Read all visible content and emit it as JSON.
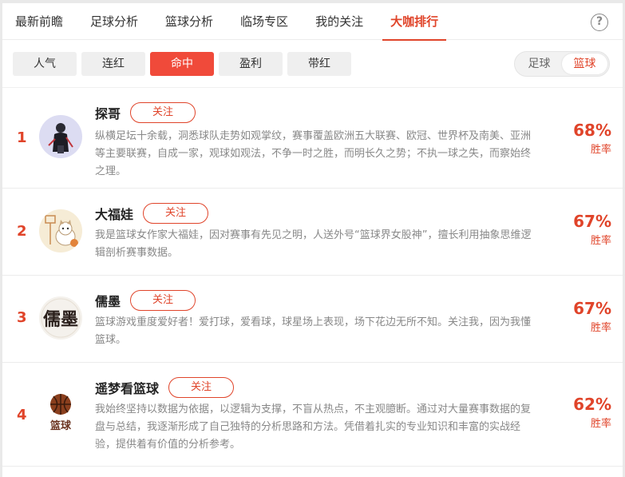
{
  "tabs": [
    {
      "label": "最新前瞻",
      "active": false
    },
    {
      "label": "足球分析",
      "active": false
    },
    {
      "label": "篮球分析",
      "active": false
    },
    {
      "label": "临场专区",
      "active": false
    },
    {
      "label": "我的关注",
      "active": false
    },
    {
      "label": "大咖排行",
      "active": true
    }
  ],
  "help_label": "?",
  "filters": [
    {
      "label": "人气",
      "active": false
    },
    {
      "label": "连红",
      "active": false
    },
    {
      "label": "命中",
      "active": true
    },
    {
      "label": "盈利",
      "active": false
    },
    {
      "label": "带红",
      "active": false
    }
  ],
  "sport_toggle": [
    {
      "label": "足球",
      "active": false
    },
    {
      "label": "篮球",
      "active": true
    }
  ],
  "follow_label": "关注",
  "experts": [
    {
      "rank": "1",
      "name": "探哥",
      "desc": "纵横足坛十余载，洞悉球队走势如观掌纹，赛事覆盖欧洲五大联赛、欧冠、世界杯及南美、亚洲等主要联赛，自成一家，观球如观法，不争一时之胜，而明长久之势；不执一球之失，而察始终之理。",
      "rate": "68%",
      "rate_label": "胜率"
    },
    {
      "rank": "2",
      "name": "大福娃",
      "desc": "我是篮球女作家大福娃，因对赛事有先见之明，人送外号“篮球界女股神”，擅长利用抽象思维逻辑剖析赛事数据。",
      "rate": "67%",
      "rate_label": "胜率"
    },
    {
      "rank": "3",
      "name": "儒墨",
      "desc": "篮球游戏重度爱好者！爱打球，爱看球，球星场上表现，场下花边无所不知。关注我，因为我懂篮球。",
      "rate": "67%",
      "rate_label": "胜率"
    },
    {
      "rank": "4",
      "name": "遥梦看篮球",
      "desc": "我始终坚持以数据为依据，以逻辑为支撑，不盲从热点，不主观臆断。通过对大量赛事数据的复盘与总结，我逐渐形成了自己独特的分析思路和方法。凭借着扎实的专业知识和丰富的实战经验，提供着有价值的分析参考。",
      "rate": "62%",
      "rate_label": "胜率"
    }
  ],
  "avatar3_text": "儒墨",
  "avatar4_text": "篮球",
  "colors": {
    "accent": "#e0442a",
    "chip_active": "#f04a3a"
  }
}
